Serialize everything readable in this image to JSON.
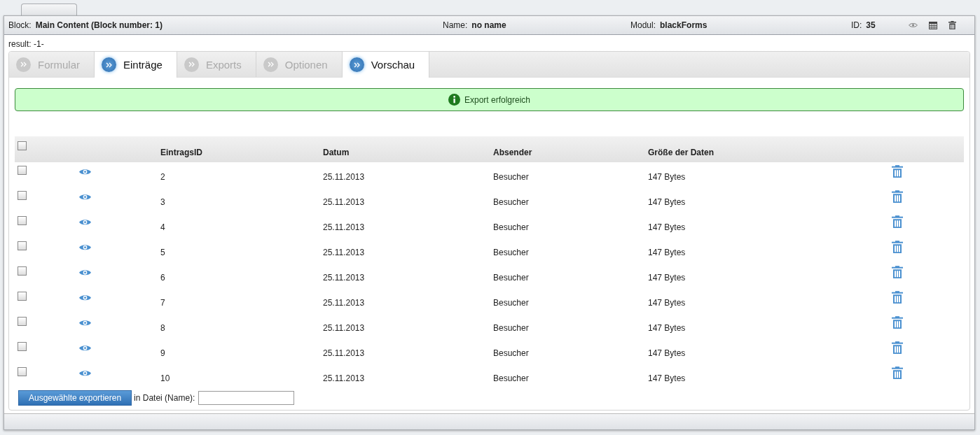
{
  "header": {
    "block_label": "Block:",
    "block_value": "Main Content (Block number: 1)",
    "name_label": "Name:",
    "name_value": "no name",
    "modul_label": "Modul:",
    "modul_value": "blackForms",
    "id_label": "ID:",
    "id_value": "35"
  },
  "result": "result: -1-",
  "tabs": [
    {
      "label": "Formular",
      "enabled": false
    },
    {
      "label": "Einträge",
      "enabled": true
    },
    {
      "label": "Exports",
      "enabled": false
    },
    {
      "label": "Optionen",
      "enabled": false
    },
    {
      "label": "Vorschau",
      "enabled": true
    }
  ],
  "message": "Export erfolgreich",
  "table": {
    "select_all_checked": false,
    "columns": [
      "EintragsID",
      "Datum",
      "Absender",
      "Größe der Daten"
    ],
    "rows": [
      {
        "checked": false,
        "cells": [
          "2",
          "25.11.2013",
          "Besucher",
          "147 Bytes"
        ]
      },
      {
        "checked": false,
        "cells": [
          "3",
          "25.11.2013",
          "Besucher",
          "147 Bytes"
        ]
      },
      {
        "checked": false,
        "cells": [
          "4",
          "25.11.2013",
          "Besucher",
          "147 Bytes"
        ]
      },
      {
        "checked": false,
        "cells": [
          "5",
          "25.11.2013",
          "Besucher",
          "147 Bytes"
        ]
      },
      {
        "checked": false,
        "cells": [
          "6",
          "25.11.2013",
          "Besucher",
          "147 Bytes"
        ]
      },
      {
        "checked": false,
        "cells": [
          "7",
          "25.11.2013",
          "Besucher",
          "147 Bytes"
        ]
      },
      {
        "checked": false,
        "cells": [
          "8",
          "25.11.2013",
          "Besucher",
          "147 Bytes"
        ]
      },
      {
        "checked": false,
        "cells": [
          "9",
          "25.11.2013",
          "Besucher",
          "147 Bytes"
        ]
      },
      {
        "checked": false,
        "cells": [
          "10",
          "25.11.2013",
          "Besucher",
          "147 Bytes"
        ]
      }
    ]
  },
  "export_button": "Ausgewählte exportieren",
  "file_label": "in Datei (Name):"
}
